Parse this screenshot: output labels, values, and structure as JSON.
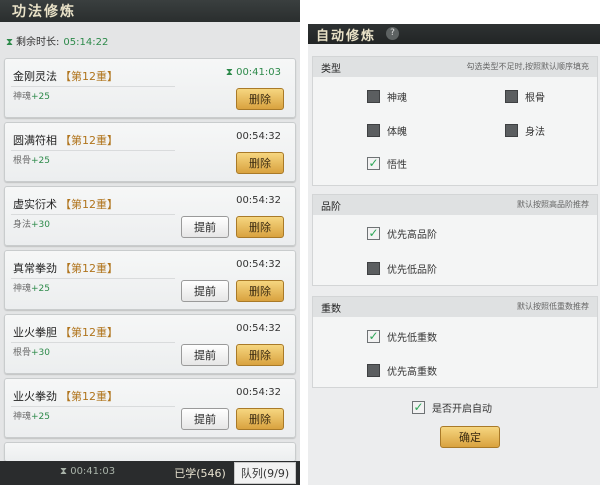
{
  "left": {
    "title": "功法修炼",
    "timer_label": "剩余时长:",
    "timer_value": "05:14:22",
    "cards": [
      {
        "name": "金刚灵法",
        "rank": "【第12重】",
        "attr": "神魂",
        "bonus": "+25",
        "time": "00:41:03",
        "active": true,
        "has_advance": false
      },
      {
        "name": "圆满符相",
        "rank": "【第12重】",
        "attr": "根骨",
        "bonus": "+25",
        "time": "00:54:32",
        "active": false,
        "has_advance": false
      },
      {
        "name": "虚实衍术",
        "rank": "【第12重】",
        "attr": "身法",
        "bonus": "+30",
        "time": "00:54:32",
        "active": false,
        "has_advance": true
      },
      {
        "name": "真常拳劲",
        "rank": "【第12重】",
        "attr": "神魂",
        "bonus": "+25",
        "time": "00:54:32",
        "active": false,
        "has_advance": true
      },
      {
        "name": "业火拳胆",
        "rank": "【第12重】",
        "attr": "根骨",
        "bonus": "+30",
        "time": "00:54:32",
        "active": false,
        "has_advance": true
      },
      {
        "name": "业火拳劲",
        "rank": "【第12重】",
        "attr": "神魂",
        "bonus": "+25",
        "time": "00:54:32",
        "active": false,
        "has_advance": true
      }
    ],
    "delete_label": "删除",
    "advance_label": "提前",
    "bottom_timer": "00:41:03",
    "tab_learned": "已学(546)",
    "tab_queue": "队列(9/9)"
  },
  "right": {
    "title": "自动修炼",
    "help": "?",
    "type_section": {
      "heading": "类型",
      "hint": "勾选类型不足时,按照默认顺序填充",
      "options": [
        {
          "label": "神魂",
          "checked": false
        },
        {
          "label": "根骨",
          "checked": false
        },
        {
          "label": "体魄",
          "checked": false
        },
        {
          "label": "身法",
          "checked": false
        },
        {
          "label": "悟性",
          "checked": true
        }
      ]
    },
    "grade_section": {
      "heading": "品阶",
      "hint": "默认按照高品阶推荐",
      "options": [
        {
          "label": "优先高品阶",
          "checked": true
        },
        {
          "label": "优先低品阶",
          "checked": false
        }
      ]
    },
    "layer_section": {
      "heading": "重数",
      "hint": "默认按照低重数推荐",
      "options": [
        {
          "label": "优先低重数",
          "checked": true
        },
        {
          "label": "优先高重数",
          "checked": false
        }
      ]
    },
    "auto_label": "是否开启自动",
    "auto_checked": true,
    "confirm_label": "确定"
  },
  "colors": {
    "gold_button": "#e3b04f",
    "green_text": "#2d8a4a",
    "rank_text": "#b0741c",
    "title_bar": "#2a2e2e"
  },
  "icons": {
    "hourglass": "hourglass-icon",
    "check": "check-icon",
    "help": "question-icon"
  }
}
